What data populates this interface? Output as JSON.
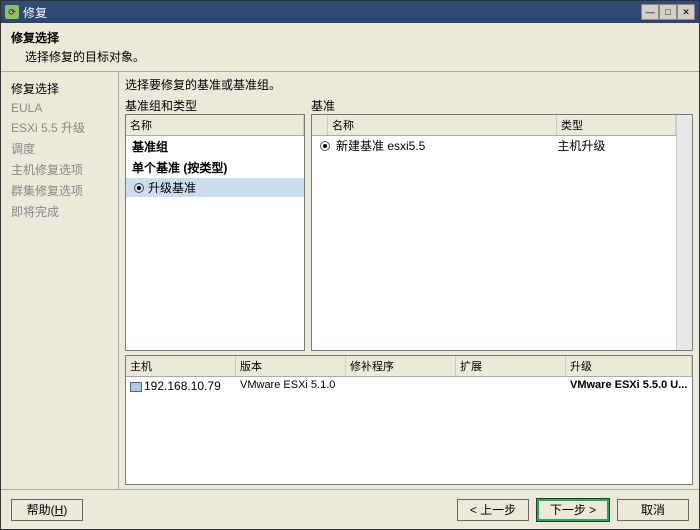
{
  "window": {
    "title": "修复"
  },
  "header": {
    "title": "修复选择",
    "subtitle": "选择修复的目标对象。"
  },
  "sidebar": {
    "items": [
      {
        "label": "修复选择",
        "active": true
      },
      {
        "label": "EULA"
      },
      {
        "label": "ESXi 5.5 升级"
      },
      {
        "label": "调度"
      },
      {
        "label": "主机修复选项"
      },
      {
        "label": "群集修复选项"
      },
      {
        "label": "即将完成"
      }
    ]
  },
  "main": {
    "instruction": "选择要修复的基准或基准组。",
    "leftPane": {
      "label": "基准组和类型",
      "col": "名称",
      "group": "基准组",
      "subgroup": "单个基准 (按类型)",
      "item": "升级基准"
    },
    "rightPane": {
      "label": "基准",
      "cols": {
        "name": "名称",
        "type": "类型"
      },
      "row": {
        "name": "新建基准 esxi5.5",
        "type": "主机升级"
      }
    },
    "hostTable": {
      "cols": {
        "host": "主机",
        "version": "版本",
        "patches": "修补程序",
        "ext": "扩展",
        "upgrade": "升级"
      },
      "row": {
        "host": "192.168.10.79",
        "version": "VMware ESXi 5.1.0",
        "patches": "",
        "ext": "",
        "upgrade": "VMware ESXi 5.5.0 U..."
      }
    }
  },
  "footer": {
    "help": "帮助(H)",
    "back": "< 上一步",
    "next": "下一步 >",
    "cancel": "取消"
  }
}
